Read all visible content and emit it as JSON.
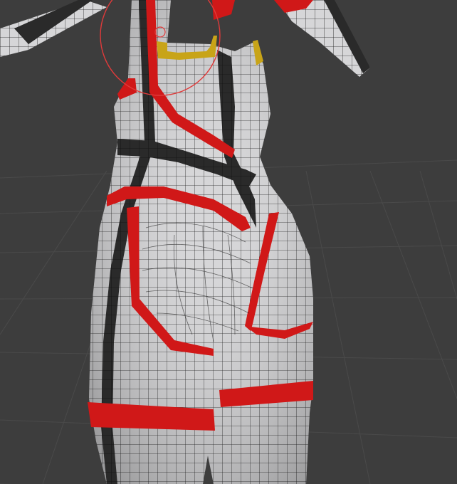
{
  "viewport": {
    "background_color": "#3d3d3d",
    "grid_color": "#4a4a4a",
    "mesh_fill_color": "#d4d4d6",
    "wire_color": "#1a1a1a",
    "red_material_color": "#d01818",
    "dark_material_color": "#262626",
    "yellow_material_color": "#c8a418",
    "brush_cursor_color": "#e03a3a"
  },
  "tool_cursor": {
    "type": "brush-circle",
    "name": "sculpt-brush-cursor-icon"
  }
}
